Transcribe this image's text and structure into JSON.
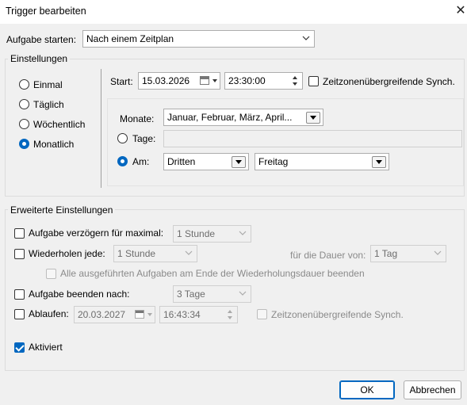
{
  "window": {
    "title": "Trigger bearbeiten",
    "close_glyph": "✕"
  },
  "start_task": {
    "label": "Aufgabe starten:",
    "value": "Nach einem Zeitplan"
  },
  "settings": {
    "group_title": "Einstellungen",
    "schedule_options": [
      "Einmal",
      "Täglich",
      "Wöchentlich",
      "Monatlich"
    ],
    "selected_schedule": "Monatlich",
    "start_label": "Start:",
    "start_date": "15.03.2026",
    "start_time": "23:30:00",
    "sync_timezones_label": "Zeitzonenübergreifende Synch.",
    "months_label": "Monate:",
    "months_value": "Januar, Februar, März, April...",
    "days_label": "Tage:",
    "days_value": "",
    "on_label": "Am:",
    "on_week": "Dritten",
    "on_weekday": "Freitag"
  },
  "advanced": {
    "group_title": "Erweiterte Einstellungen",
    "delay_label": "Aufgabe verzögern für maximal:",
    "delay_value": "1 Stunde",
    "repeat_label": "Wiederholen jede:",
    "repeat_value": "1 Stunde",
    "duration_label": "für die Dauer von:",
    "duration_value": "1 Tag",
    "stop_all_label": "Alle ausgeführten Aufgaben am Ende der Wiederholungsdauer beenden",
    "stop_after_label": "Aufgabe beenden nach:",
    "stop_after_value": "3 Tage",
    "expire_label": "Ablaufen:",
    "expire_date": "20.03.2027",
    "expire_time": "16:43:34",
    "expire_sync_label": "Zeitzonenübergreifende Synch.",
    "enabled_label": "Aktiviert"
  },
  "buttons": {
    "ok": "OK",
    "cancel": "Abbrechen"
  },
  "colors": {
    "accent": "#0067c0",
    "background": "#f0f0f0"
  }
}
